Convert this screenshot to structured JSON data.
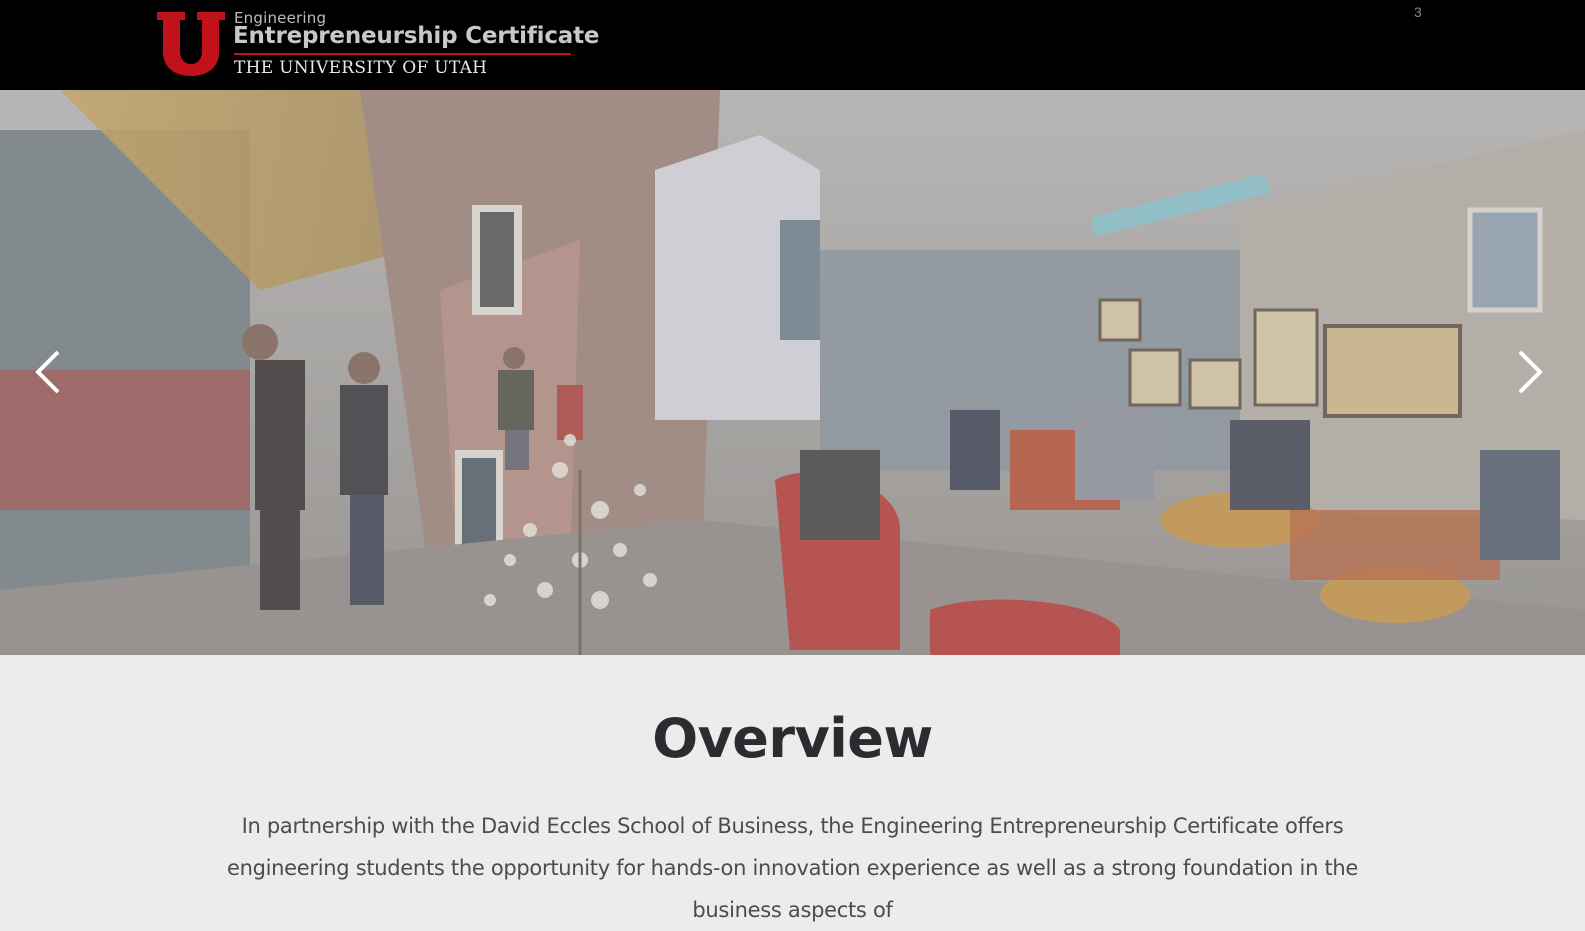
{
  "header": {
    "logo": {
      "line1": "Engineering",
      "line2": "Entrepreneurship Certificate",
      "line3": "THE UNIVERSITY OF UTAH"
    },
    "slide_counter": "3"
  },
  "hero": {
    "image_description_name": "campus-building-interior-photo",
    "prev_icon": "chevron-left-icon",
    "next_icon": "chevron-right-icon"
  },
  "overview": {
    "title": "Overview",
    "text": "In partnership with the David Eccles School of Business, the Engineering Entrepreneurship Certificate offers engineering students the opportunity for hands-on innovation experience as well as a strong foundation in the business aspects of"
  },
  "colors": {
    "header_bg": "#000000",
    "brand_red": "#c1121c",
    "page_bg": "#ececec",
    "heading": "#2a2c30"
  }
}
